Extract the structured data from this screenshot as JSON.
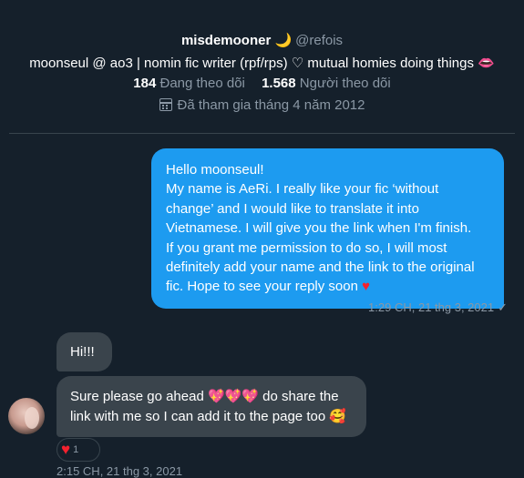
{
  "profile": {
    "display_name": "misdemooner 🌙",
    "handle": "@refois",
    "bio": "moonseul @ ao3 | nomin fic writer (rpf/rps) ♡ mutual homies doing things 👄",
    "following_count": "184",
    "following_label": "Đang theo dõi",
    "followers_count": "1.568",
    "followers_label": "Người theo dõi",
    "joined": "Đã tham gia tháng 4 năm 2012",
    "joined_icon": "calendar-icon"
  },
  "messages": {
    "outgoing": {
      "lines": [
        "Hello moonseul!",
        "My name is AeRi. I really like your fic ‘without change’ and I would like to translate it into Vietnamese. I will give you the link when I'm finish.",
        "If you grant me permission to do so, I will most definitely add your name and the link to the original fic. Hope to see your reply soon"
      ],
      "heart": "♥",
      "timestamp": "1:29 CH, 21 thg 3, 2021",
      "status_icon": "✓"
    },
    "incoming": {
      "first": "Hi!!!",
      "second_part1": "Sure please go ahead 💖💖💖 do share the link with me so I can add it to the page too",
      "second_emoji": "🥰",
      "reaction": "♥",
      "reaction_count": "1",
      "timestamp": "2:15 CH, 21 thg 3, 2021"
    }
  },
  "colors": {
    "background": "#15202b",
    "outgoing_bubble": "#1d9bf0",
    "incoming_bubble": "#3a444c",
    "muted_text": "#8b98a5",
    "heart": "#f4212e"
  }
}
